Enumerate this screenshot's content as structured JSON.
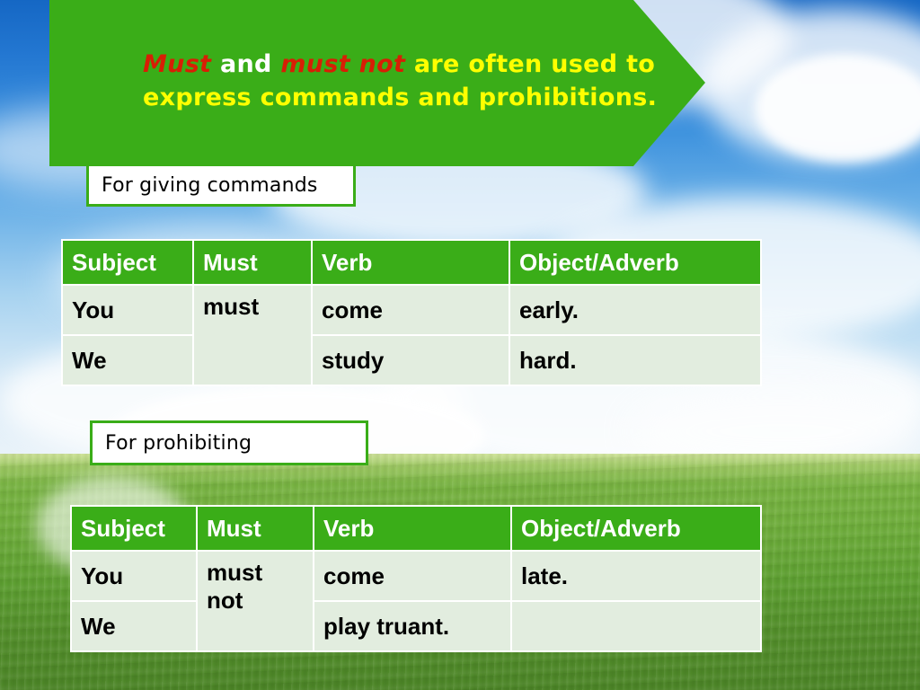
{
  "banner": {
    "line1_part1": "Must",
    "line1_part2": " and ",
    "line1_part3": "must not",
    "line1_part4": " are often used to",
    "line2": "express commands and prohibitions.",
    "bg_color": "#3aad18",
    "red": "#d81e05",
    "yellow": "#ffff00"
  },
  "labels": {
    "commands": "For giving commands",
    "prohibiting": "For prohibiting"
  },
  "commands_table": {
    "headers": [
      "Subject",
      "Must",
      "Verb",
      "Object/Adverb"
    ],
    "rows": [
      [
        "You",
        "must",
        "come",
        "early."
      ],
      [
        "We",
        "",
        "study",
        "hard."
      ]
    ]
  },
  "prohibit_table": {
    "headers": [
      "Subject",
      "Must",
      "Verb",
      "Object/Adverb"
    ],
    "rows": [
      [
        "You",
        "must not",
        "come",
        "late."
      ],
      [
        "We",
        "",
        "play truant.",
        ""
      ]
    ]
  }
}
